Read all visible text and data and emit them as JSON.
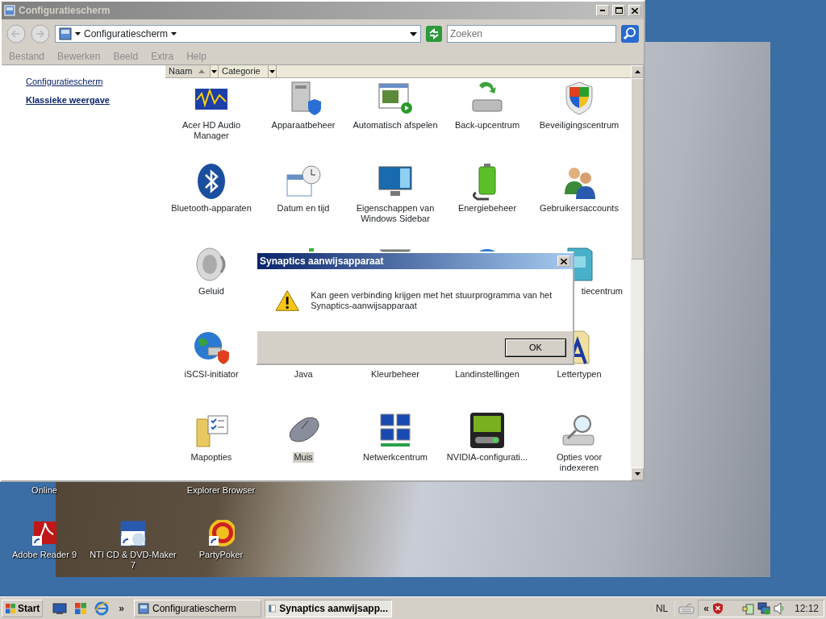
{
  "window": {
    "title": "Configuratiescherm"
  },
  "address": {
    "location": "Configuratiescherm"
  },
  "search": {
    "placeholder": "Zoeken"
  },
  "menu": [
    "Bestand",
    "Bewerken",
    "Beeld",
    "Extra",
    "Help"
  ],
  "sidebar": {
    "items": [
      {
        "label": "Configuratiescherm",
        "selected": false
      },
      {
        "label": "Klassieke weergave",
        "selected": true
      }
    ]
  },
  "columns": [
    {
      "label": "Naam",
      "sorted": true
    },
    {
      "label": "Categorie",
      "sorted": false
    }
  ],
  "items": [
    {
      "label": "Acer HD Audio Manager",
      "selected": false
    },
    {
      "label": "Apparaatbeheer",
      "selected": false
    },
    {
      "label": "Automatisch afspelen",
      "selected": false
    },
    {
      "label": "Back-upcentrum",
      "selected": false
    },
    {
      "label": "Beveiligingscentrum",
      "selected": false
    },
    {
      "label": "Bluetooth-apparaten",
      "selected": false
    },
    {
      "label": "Datum en tijd",
      "selected": false
    },
    {
      "label": "Eigenschappen van Windows Sidebar",
      "selected": false
    },
    {
      "label": "Energiebeheer",
      "selected": false
    },
    {
      "label": "Gebruikersaccounts",
      "selected": false
    },
    {
      "label": "Geluid",
      "selected": false
    },
    {
      "selected": false
    },
    {
      "selected": false
    },
    {
      "selected": false
    },
    {
      "label": "tiecentrum",
      "selected": false
    },
    {
      "label": "iSCSI-initiator",
      "selected": false
    },
    {
      "label": "Java",
      "selected": false
    },
    {
      "label": "Kleurbeheer",
      "selected": false
    },
    {
      "label": "Landinstellingen",
      "selected": false
    },
    {
      "label": "Lettertypen",
      "selected": false
    },
    {
      "label": "Mapopties",
      "selected": false
    },
    {
      "label": "Muis",
      "selected": true
    },
    {
      "label": "Netwerkcentrum",
      "selected": false
    },
    {
      "label": "NVIDIA-configurati...",
      "selected": false
    },
    {
      "label": "Opties voor indexeren",
      "selected": false
    }
  ],
  "dialog": {
    "title": "Synaptics aanwijsapparaat",
    "message": "Kan geen verbinding krijgen met het stuurprogramma van het Synaptics-aanwijsapparaat",
    "buttons": [
      "OK"
    ]
  },
  "desktop_icons": [
    {
      "label": "Online"
    },
    {
      "label": "Explorer Browser"
    },
    {
      "label": "Adobe Reader 9"
    },
    {
      "label": "NTI CD & DVD-Maker 7"
    },
    {
      "label": "PartyPoker"
    }
  ],
  "taskbar": {
    "start": "Start",
    "overflow": "»",
    "tasks": [
      {
        "label": "Configuratiescherm",
        "selected": false
      },
      {
        "label": "Synaptics aanwijsapp...",
        "selected": true
      }
    ],
    "language": "NL",
    "tray_toggle": "«",
    "clock": "12:12"
  }
}
